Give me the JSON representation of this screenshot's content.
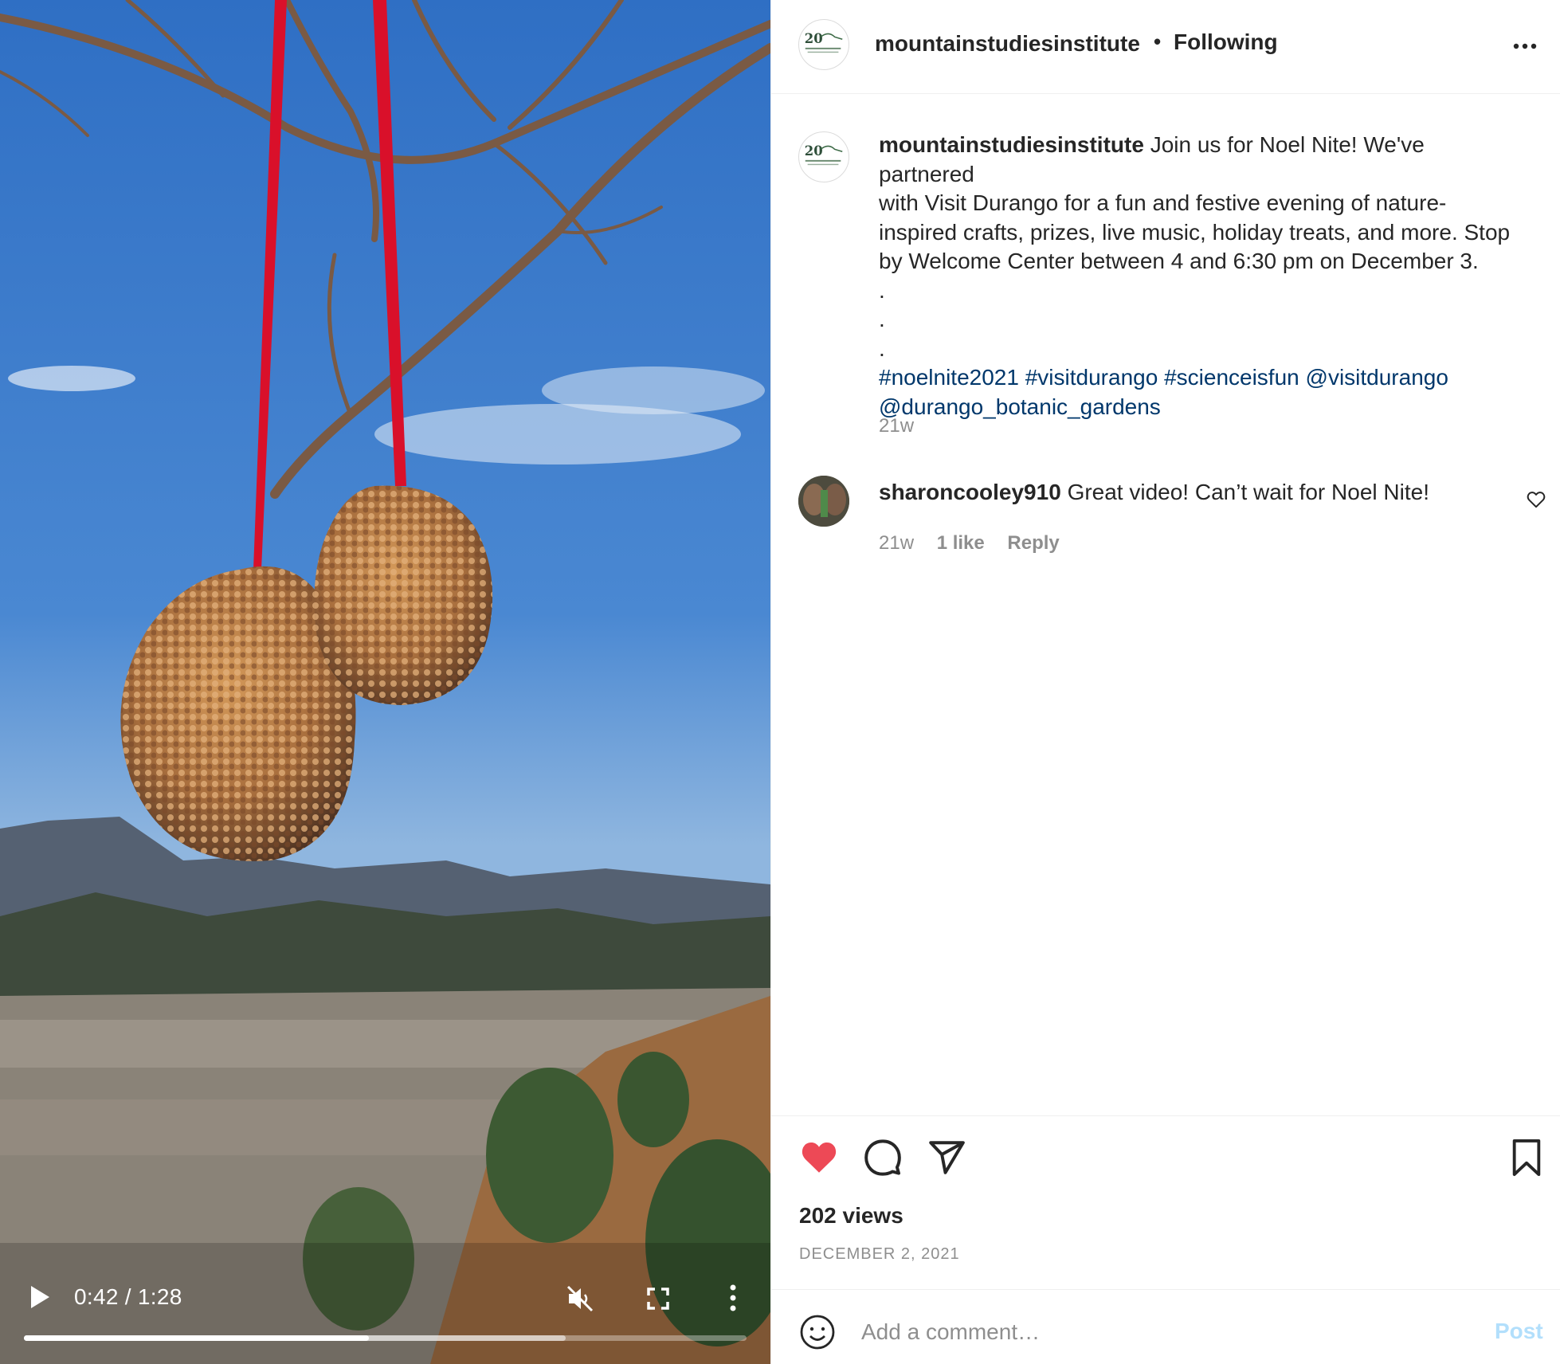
{
  "video": {
    "current_time": "0:42",
    "duration": "1:28",
    "time_display": "0:42 / 1:28",
    "progress_fraction": 0.477,
    "buffered_fraction": 0.75,
    "muted": true,
    "icons": {
      "play": "play-icon",
      "mute": "muted-speaker-icon",
      "fullscreen": "fullscreen-icon",
      "more": "vertical-ellipsis-icon"
    }
  },
  "header": {
    "username": "mountainstudiesinstitute",
    "separator": "•",
    "follow_status": "Following",
    "more_icon": "horizontal-ellipsis-icon"
  },
  "caption": {
    "username": "mountainstudiesinstitute",
    "lines": [
      "Join us for Noel Nite! We've partnered",
      "with Visit Durango for a fun and festive evening of nature-",
      "inspired crafts, prizes, live music, holiday treats, and more. Stop",
      "by Welcome Center between 4 and 6:30 pm on December 3."
    ],
    "dots": [
      ".",
      ".",
      "."
    ],
    "tags_line1": [
      "#noelnite2021",
      "#visitdurango",
      "#scienceisfun",
      "@visitdurango"
    ],
    "tags_line2": [
      "@durango_botanic_gardens"
    ],
    "time": "21w"
  },
  "comment": {
    "username": "sharoncooley910",
    "text": "Great video! Can’t wait for Noel Nite!",
    "time": "21w",
    "likes": "1 like",
    "reply_label": "Reply"
  },
  "actions": {
    "liked": true,
    "like_color": "#ed4956",
    "icons": [
      "heart-icon",
      "comment-icon",
      "share-icon",
      "bookmark-icon"
    ]
  },
  "stats": {
    "views": "202 views",
    "date": "DECEMBER 2, 2021"
  },
  "add_comment": {
    "placeholder": "Add a comment…",
    "post_label": "Post",
    "post_color": "#b2dffc"
  },
  "colors": {
    "text": "#262626",
    "muted": "#8e8e8e",
    "link": "#00376b",
    "divider": "#efefef"
  }
}
